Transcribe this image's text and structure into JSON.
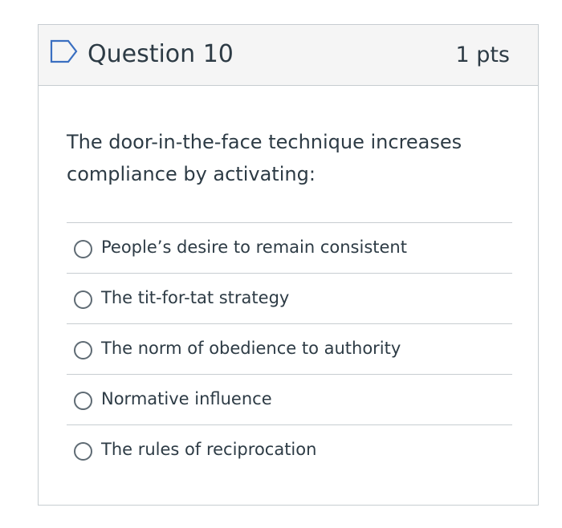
{
  "question": {
    "title": "Question 10",
    "points": "1 pts",
    "text": "The door-in-the-face technique increases compliance by activating:",
    "flag_icon": "flag-outline-icon",
    "answers": [
      {
        "label": "People’s desire to remain consistent",
        "selected": false
      },
      {
        "label": "The tit-for-tat strategy",
        "selected": false
      },
      {
        "label": "The norm of obedience to authority",
        "selected": false
      },
      {
        "label": "Normative influence",
        "selected": false
      },
      {
        "label": "The rules of reciprocation",
        "selected": false
      }
    ]
  },
  "colors": {
    "text": "#2d3b45",
    "border": "#c7cdd1",
    "header_bg": "#f5f5f5",
    "accent": "#3a6fc1"
  }
}
